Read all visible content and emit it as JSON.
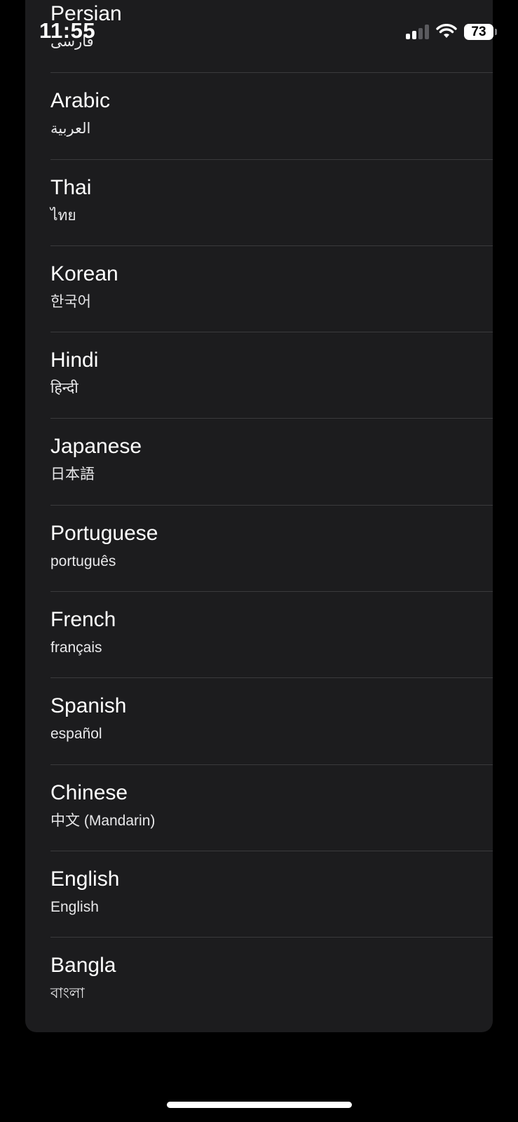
{
  "status_bar": {
    "time": "11:55",
    "battery_level": "73"
  },
  "languages": [
    {
      "name": "Persian",
      "native": "فارسی"
    },
    {
      "name": "Arabic",
      "native": "العربية"
    },
    {
      "name": "Thai",
      "native": "ไทย"
    },
    {
      "name": "Korean",
      "native": "한국어"
    },
    {
      "name": "Hindi",
      "native": "हिन्दी"
    },
    {
      "name": "Japanese",
      "native": "日本語"
    },
    {
      "name": "Portuguese",
      "native": "português"
    },
    {
      "name": "French",
      "native": "français"
    },
    {
      "name": "Spanish",
      "native": "español"
    },
    {
      "name": "Chinese",
      "native": "中文 (Mandarin)"
    },
    {
      "name": "English",
      "native": "English"
    },
    {
      "name": "Bangla",
      "native": "বাংলা"
    }
  ],
  "colors": {
    "background": "#000000",
    "sheet": "#1c1c1e",
    "separator": "#3a3a3c",
    "text": "#ffffff"
  }
}
